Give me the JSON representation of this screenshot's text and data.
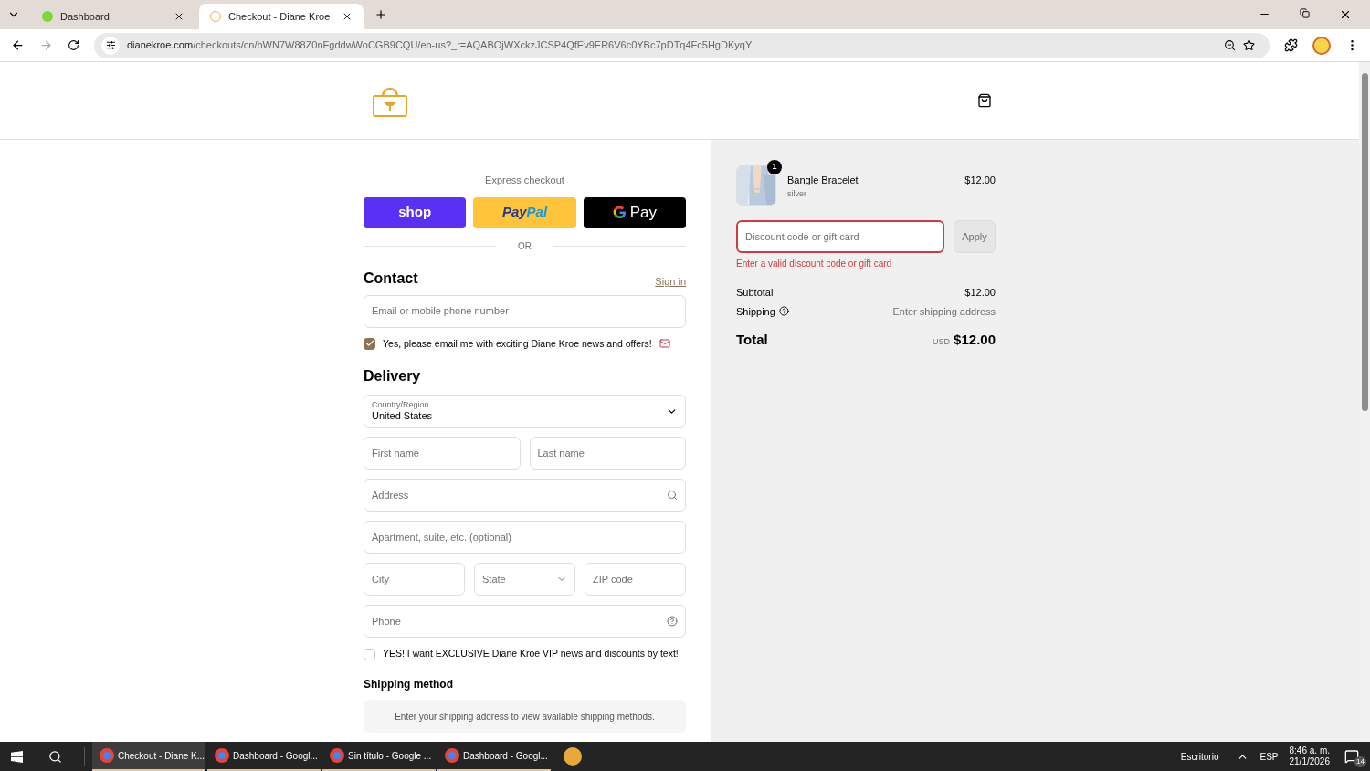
{
  "browser": {
    "tabs": [
      {
        "title": "Dashboard",
        "selected": false
      },
      {
        "title": "Checkout - Diane Kroe",
        "selected": true
      }
    ],
    "url": {
      "domain": "dianekroe.com",
      "path": "/checkouts/cn/hWN7W88Z0nFgddwWoCGB9CQU/en-us?_r=AQABOjWXckzJCSP4QfEv9ER6V6c0YBc7pDTq4Fc5HgDKyqY"
    }
  },
  "express": {
    "title": "Express checkout",
    "buttons": [
      {
        "kind": "shop",
        "label": "shop"
      },
      {
        "kind": "paypal",
        "label": "Pay",
        "label_2": "Pal"
      },
      {
        "kind": "gpay",
        "label": "Pay"
      }
    ],
    "divider": "OR"
  },
  "contact": {
    "heading": "Contact",
    "sign_in": "Sign in",
    "email_placeholder": "Email or mobile phone number",
    "newsletter": {
      "label": "Yes, please email me with exciting Diane Kroe news and offers!",
      "checked": true
    }
  },
  "delivery": {
    "heading": "Delivery",
    "country": {
      "label": "Country/Region",
      "value": "United States"
    },
    "first_name": "First name",
    "last_name": "Last name",
    "address": "Address",
    "apartment": "Apartment, suite, etc. (optional)",
    "city": "City",
    "state": "State",
    "zip": "ZIP code",
    "phone": "Phone",
    "sms": {
      "label": "YES! I want EXCLUSIVE Diane Kroe VIP news and discounts by text!",
      "checked": false
    }
  },
  "shipping_method": {
    "heading": "Shipping method",
    "message": "Enter your shipping address to view available shipping methods."
  },
  "summary": {
    "items": [
      {
        "name": "Bangle Bracelet",
        "variant": "silver",
        "price": "$12.00",
        "quantity": "1"
      }
    ],
    "discount": {
      "placeholder": "Discount code or gift card",
      "error": "Enter a valid discount code or gift card"
    },
    "apply": "Apply",
    "subtotal": {
      "label": "Subtotal",
      "value": "$12.00"
    },
    "shipping": {
      "label": "Shipping",
      "value": "Enter shipping address"
    },
    "total": {
      "label": "Total",
      "currency": "USD",
      "value": "$12.00"
    }
  },
  "taskbar": {
    "windows": [
      {
        "label": "Checkout - Diane K...",
        "selected": true
      },
      {
        "label": "Dashboard - Googl...",
        "selected": false
      },
      {
        "label": "Sin título - Google ...",
        "selected": false
      },
      {
        "label": "Dashboard - Googl...",
        "selected": false
      }
    ],
    "desktop": "Escritorio",
    "language": "ESP",
    "time": "8:46 a. m.",
    "date": "21/1/2026",
    "notifications": "14"
  }
}
